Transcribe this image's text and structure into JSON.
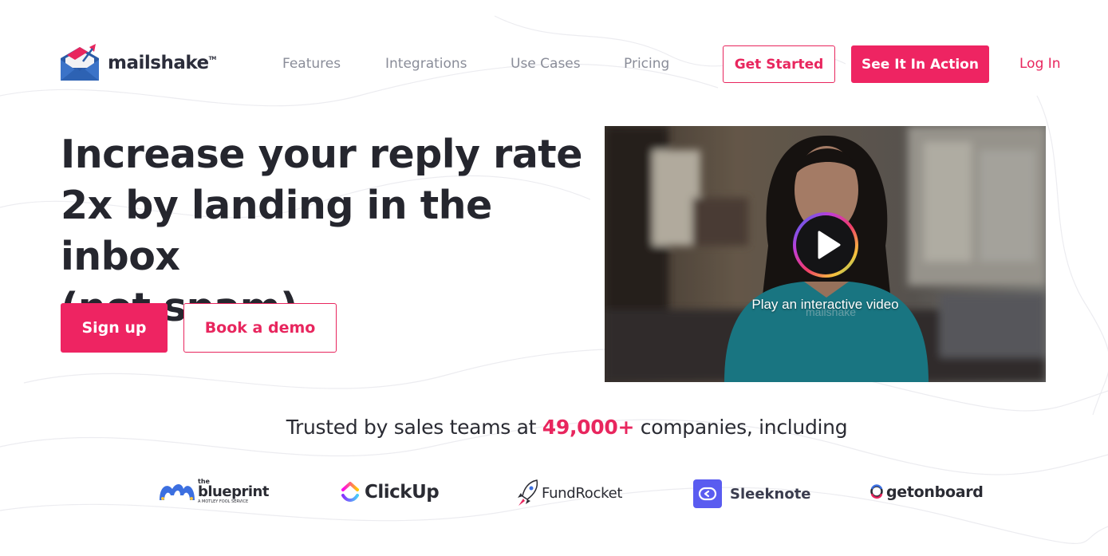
{
  "header": {
    "logo_text": "mailshake",
    "logo_tm": "TM",
    "nav": [
      "Features",
      "Integrations",
      "Use Cases",
      "Pricing"
    ],
    "get_started": "Get Started",
    "see_it": "See It In Action",
    "login": "Log In"
  },
  "hero": {
    "title_lines": [
      "Increase your reply rate",
      "2x by landing in the inbox",
      "(not spam)."
    ],
    "signup": "Sign up",
    "demo": "Book a demo"
  },
  "video": {
    "caption": "Play an interactive video",
    "shirt_text": "mailshake"
  },
  "trusted": {
    "prefix": "Trusted by sales teams at ",
    "count": "49,000+",
    "suffix": " companies, including"
  },
  "brands": {
    "blueprint_small": "the",
    "blueprint_main": "blueprint",
    "blueprint_sub": "A MOTLEY FOOL SERVICE",
    "clickup": "ClickUp",
    "fundrocket": "FundRocket",
    "sleeknote": "Sleeknote",
    "getonboard": "getonboard"
  },
  "colors": {
    "accent": "#ee2462",
    "accent_text": "#e8265e",
    "nav_text": "#8a8d99",
    "heading": "#25262e"
  }
}
